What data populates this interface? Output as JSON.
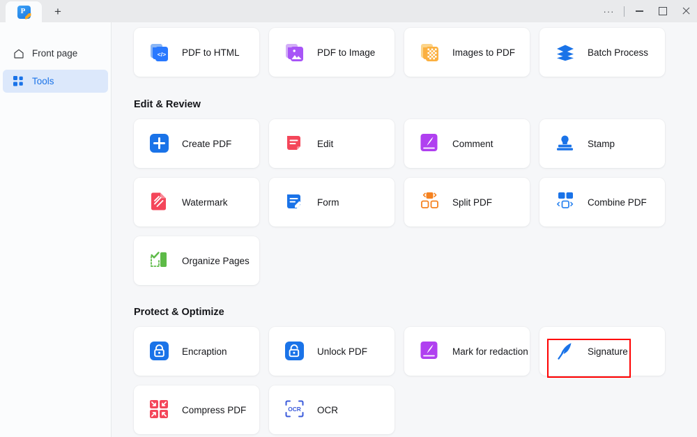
{
  "window": {
    "tab_icon": "app-logo-icon",
    "new_tab_label": "+",
    "controls": {
      "more_label": "···",
      "minimize_label": "minimize",
      "maximize_label": "maximize",
      "close_label": "close"
    }
  },
  "sidebar": {
    "items": [
      {
        "label": "Front page",
        "icon": "home-icon",
        "active": false
      },
      {
        "label": "Tools",
        "icon": "grid-icon",
        "active": true
      }
    ]
  },
  "main": {
    "top_row": [
      {
        "label": "PDF to HTML",
        "icon": "pdf-to-html-icon",
        "color": "#2979ff"
      },
      {
        "label": "PDF to Image",
        "icon": "pdf-to-image-icon",
        "color": "#a855f7"
      },
      {
        "label": "Images to PDF",
        "icon": "images-to-pdf-icon",
        "color": "#fbb040"
      },
      {
        "label": "Batch Process",
        "icon": "batch-process-icon",
        "color": "#1a73e8"
      }
    ],
    "sections": [
      {
        "title": "Edit & Review",
        "rows": [
          [
            {
              "label": "Create PDF",
              "icon": "create-pdf-icon",
              "color": "#1a73e8"
            },
            {
              "label": "Edit",
              "icon": "edit-icon",
              "color": "#f4465a"
            },
            {
              "label": "Comment",
              "icon": "comment-icon",
              "color": "#b040f0"
            },
            {
              "label": "Stamp",
              "icon": "stamp-icon",
              "color": "#1a73e8"
            }
          ],
          [
            {
              "label": "Watermark",
              "icon": "watermark-icon",
              "color": "#f4465a"
            },
            {
              "label": "Form",
              "icon": "form-icon",
              "color": "#1a73e8"
            },
            {
              "label": "Split PDF",
              "icon": "split-pdf-icon",
              "color": "#f58220"
            },
            {
              "label": "Combine PDF",
              "icon": "combine-pdf-icon",
              "color": "#1a73e8"
            }
          ],
          [
            {
              "label": "Organize Pages",
              "icon": "organize-pages-icon",
              "color": "#5dba47"
            }
          ]
        ]
      },
      {
        "title": "Protect & Optimize",
        "rows": [
          [
            {
              "label": "Encraption",
              "icon": "encryption-icon",
              "color": "#1a73e8"
            },
            {
              "label": "Unlock PDF",
              "icon": "unlock-pdf-icon",
              "color": "#1a73e8"
            },
            {
              "label": "Mark for redaction",
              "icon": "mark-for-redaction-icon",
              "color": "#b040f0"
            },
            {
              "label": "Signature",
              "icon": "signature-icon",
              "color": "#1a73e8",
              "highlighted": true
            }
          ],
          [
            {
              "label": "Compress PDF",
              "icon": "compress-pdf-icon",
              "color": "#f4465a"
            },
            {
              "label": "OCR",
              "icon": "ocr-icon",
              "color": "#3b5bdb"
            }
          ]
        ]
      }
    ],
    "highlight": {
      "color": "#ff0000",
      "target": "Signature"
    }
  }
}
